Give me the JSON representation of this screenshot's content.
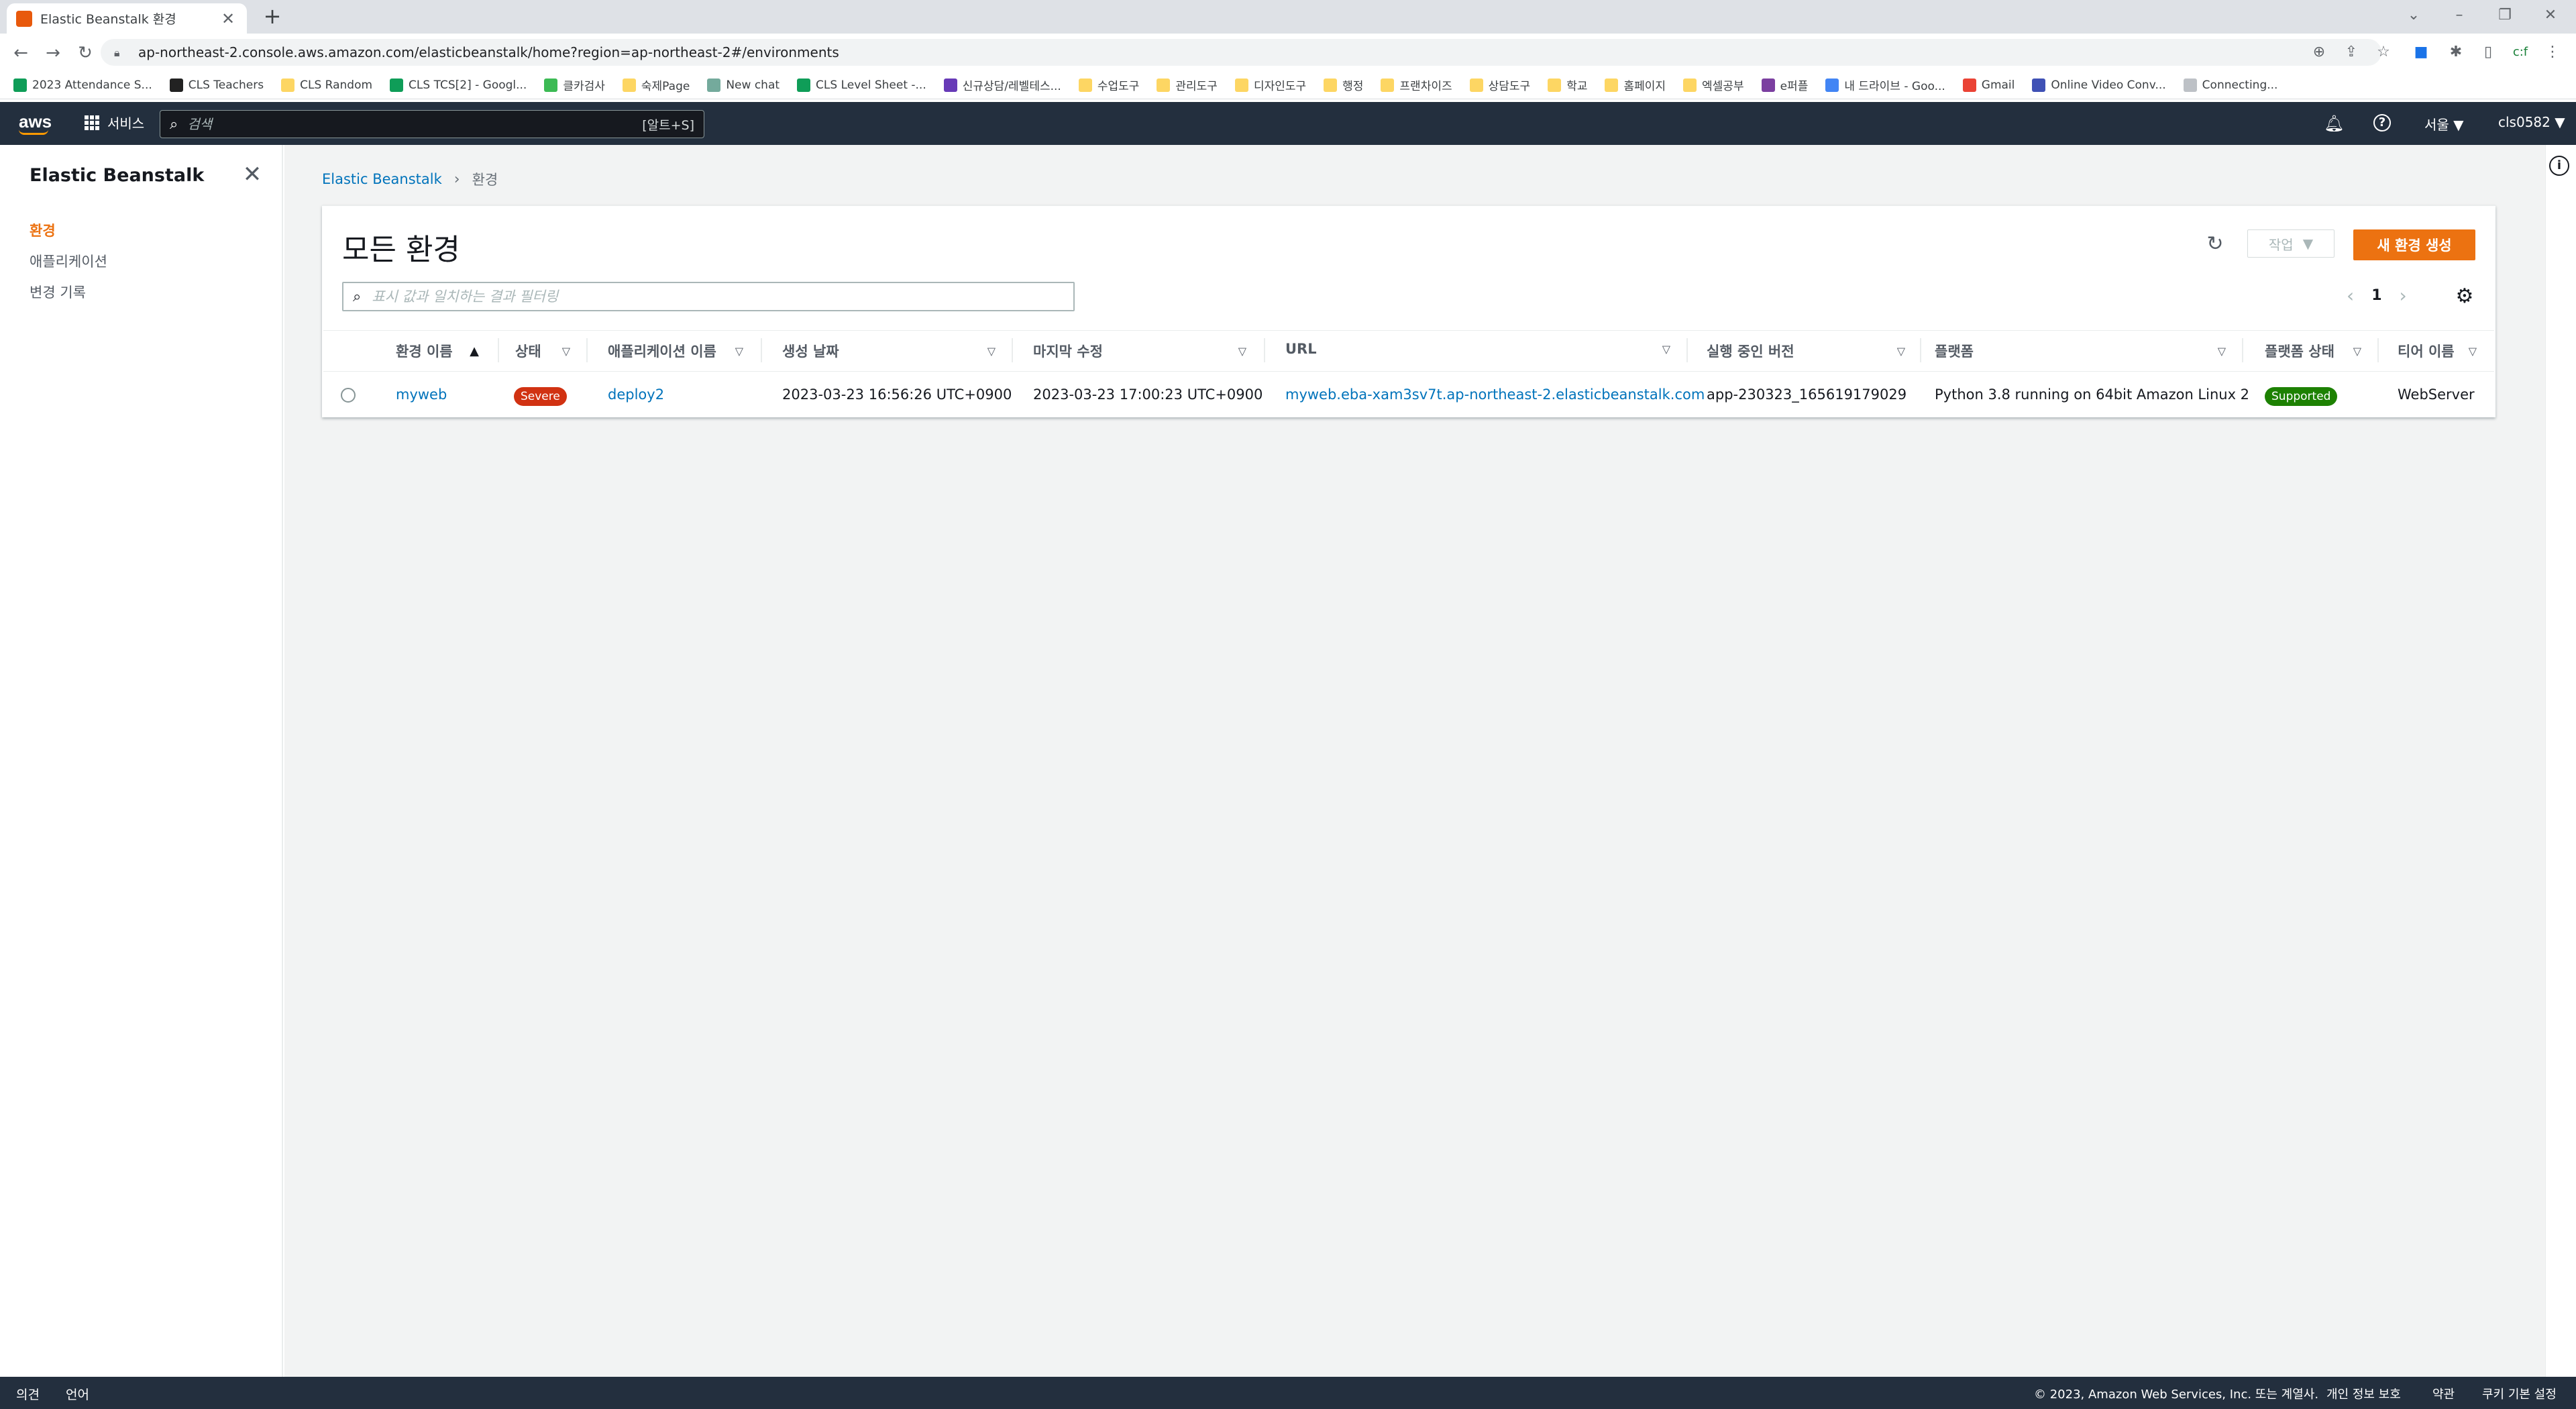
{
  "browser": {
    "tab_title": "Elastic Beanstalk 환경",
    "url": "ap-northeast-2.console.aws.amazon.com/elasticbeanstalk/home?region=ap-northeast-2#/environments",
    "bookmarks": [
      {
        "label": "2023 Attendance S...",
        "color": "#0f9d58"
      },
      {
        "label": "CLS Teachers",
        "color": "#222222"
      },
      {
        "label": "CLS Random",
        "color": "#fdd663"
      },
      {
        "label": "CLS TCS[2] - Googl...",
        "color": "#0f9d58"
      },
      {
        "label": "클카검사",
        "color": "#3cba54"
      },
      {
        "label": "숙제Page",
        "color": "#fdd663"
      },
      {
        "label": "New chat",
        "color": "#74aa9c"
      },
      {
        "label": "CLS Level Sheet -...",
        "color": "#0f9d58"
      },
      {
        "label": "신규상담/레벨테스...",
        "color": "#673ab7"
      },
      {
        "label": "수업도구",
        "color": "#fdd663"
      },
      {
        "label": "관리도구",
        "color": "#fdd663"
      },
      {
        "label": "디자인도구",
        "color": "#fdd663"
      },
      {
        "label": "행정",
        "color": "#fdd663"
      },
      {
        "label": "프랜차이즈",
        "color": "#fdd663"
      },
      {
        "label": "상담도구",
        "color": "#fdd663"
      },
      {
        "label": "학교",
        "color": "#fdd663"
      },
      {
        "label": "홈페이지",
        "color": "#fdd663"
      },
      {
        "label": "엑셀공부",
        "color": "#fdd663"
      },
      {
        "label": "e퍼플",
        "color": "#7b3fa0"
      },
      {
        "label": "내 드라이브 - Goo...",
        "color": "#4285f4"
      },
      {
        "label": "Gmail",
        "color": "#ea4335"
      },
      {
        "label": "Online Video Conv...",
        "color": "#3f51b5"
      },
      {
        "label": "Connecting...",
        "color": "#bdc1c6"
      }
    ]
  },
  "aws_header": {
    "logo": "aws",
    "services_label": "서비스",
    "search_placeholder": "검색",
    "search_shortcut": "[알트+S]",
    "region": "서울 ▼",
    "account": "cls0582 ▼"
  },
  "sidebar": {
    "title": "Elastic Beanstalk",
    "items": [
      {
        "label": "환경",
        "active": true
      },
      {
        "label": "애플리케이션",
        "active": false
      },
      {
        "label": "변경 기록",
        "active": false
      }
    ]
  },
  "breadcrumb": {
    "root": "Elastic Beanstalk",
    "current": "환경"
  },
  "panel": {
    "title": "모든 환경",
    "actions_label": "작업",
    "create_label": "새 환경 생성",
    "filter_placeholder": "표시 값과 일치하는 결과 필터링",
    "page": "1"
  },
  "table": {
    "columns": [
      "환경 이름",
      "상태",
      "애플리케이션 이름",
      "생성 날짜",
      "마지막 수정",
      "URL",
      "실행 중인 버전",
      "플랫폼",
      "플랫폼 상태",
      "티어 이름"
    ],
    "rows": [
      {
        "env_name": "myweb",
        "status": "Severe",
        "app_name": "deploy2",
        "created": "2023-03-23 16:56:26 UTC+0900",
        "modified": "2023-03-23 17:00:23 UTC+0900",
        "url": "myweb.eba-xam3sv7t.ap-northeast-2.elasticbeanstalk.com",
        "version": "app-230323_165619179029",
        "platform": "Python 3.8 running on 64bit Amazon Linux 2",
        "platform_status": "Supported",
        "tier": "WebServer"
      }
    ]
  },
  "footer": {
    "feedback": "의견",
    "language": "언어",
    "copyright": "© 2023, Amazon Web Services, Inc. 또는 계열사.",
    "privacy": "개인 정보 보호",
    "terms": "약관",
    "cookies": "쿠키 기본 설정"
  },
  "colors": {
    "aws_nav": "#232f3e",
    "accent": "#ec7211",
    "link": "#0073bb",
    "severe": "#d13212",
    "supported": "#1d8102"
  }
}
